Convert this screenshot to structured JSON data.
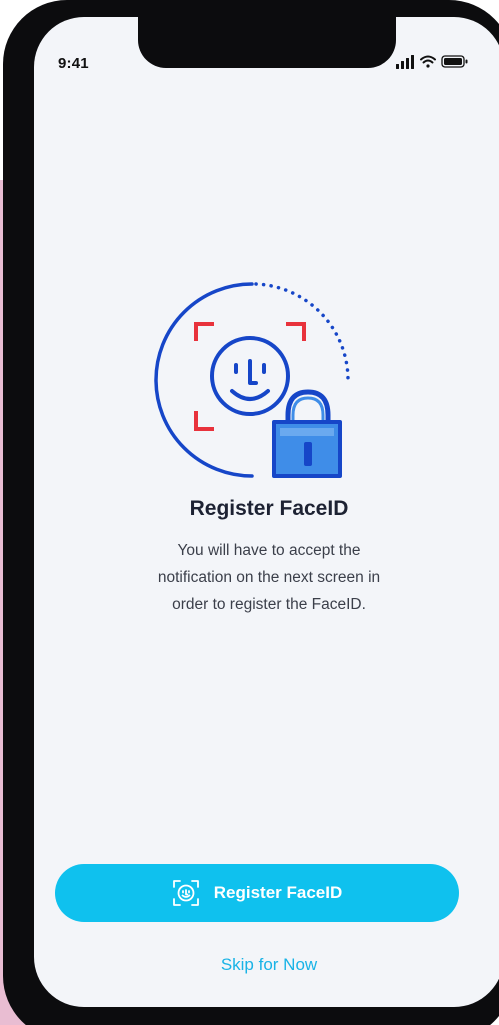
{
  "status_bar": {
    "time": "9:41",
    "icons": [
      "signal-icon",
      "wifi-icon",
      "battery-icon"
    ]
  },
  "illustration": {
    "icons": [
      "face-scan-icon",
      "padlock-icon"
    ]
  },
  "content": {
    "title": "Register FaceID",
    "description_lines": [
      "You will have to accept the",
      "notification on the next screen in",
      "order to register the FaceID."
    ]
  },
  "actions": {
    "primary_label": "Register FaceID",
    "primary_icon": "face-scan-icon",
    "skip_label": "Skip for Now"
  },
  "colors": {
    "primary": "#0fc1ee",
    "link": "#19b3e6",
    "illustration_blue": "#1646c8",
    "scan_corner_red": "#e8323c",
    "lock_blue": "#3f8de8",
    "background_accent": "#e9bdd2"
  }
}
